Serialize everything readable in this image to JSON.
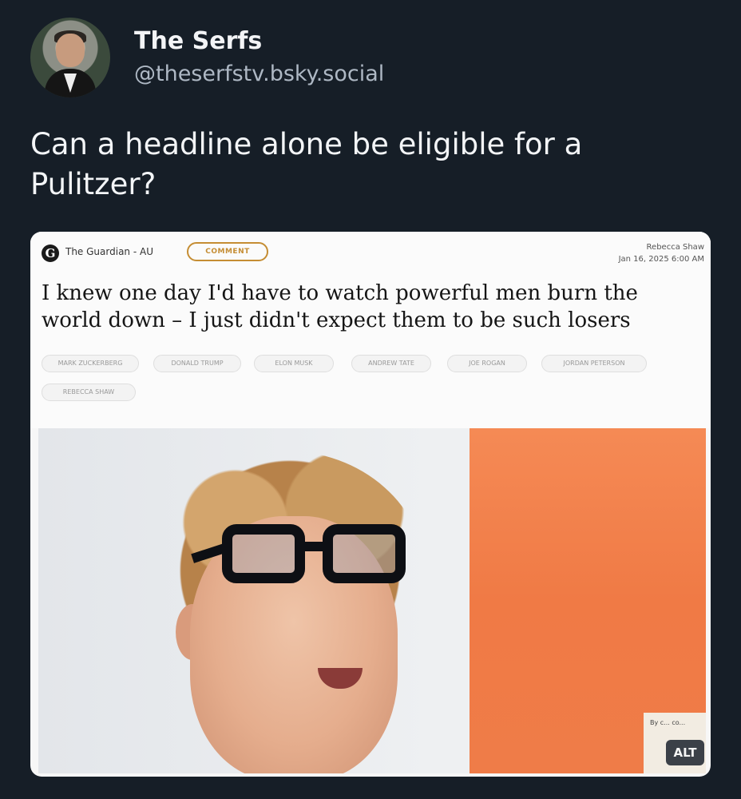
{
  "post": {
    "display_name": "The Serfs",
    "handle": "@theserfstv.bsky.social",
    "text": "Can a headline alone be eligible for a Pulitzer?"
  },
  "article": {
    "logo_letter": "G",
    "source": "The Guardian - AU",
    "section_badge": "COMMENT",
    "author": "Rebecca Shaw",
    "date": "Jan 16, 2025 6:00 AM",
    "headline": "I knew one day I'd have to watch powerful men burn the world down – I just didn't expect them to be such losers",
    "tags": [
      "MARK ZUCKERBERG",
      "DONALD TRUMP",
      "ELON MUSK",
      "ANDREW TATE",
      "JOE ROGAN",
      "JORDAN PETERSON",
      "REBECCA SHAW"
    ],
    "photo_credit": "By c... co...",
    "alt_badge": "ALT"
  }
}
